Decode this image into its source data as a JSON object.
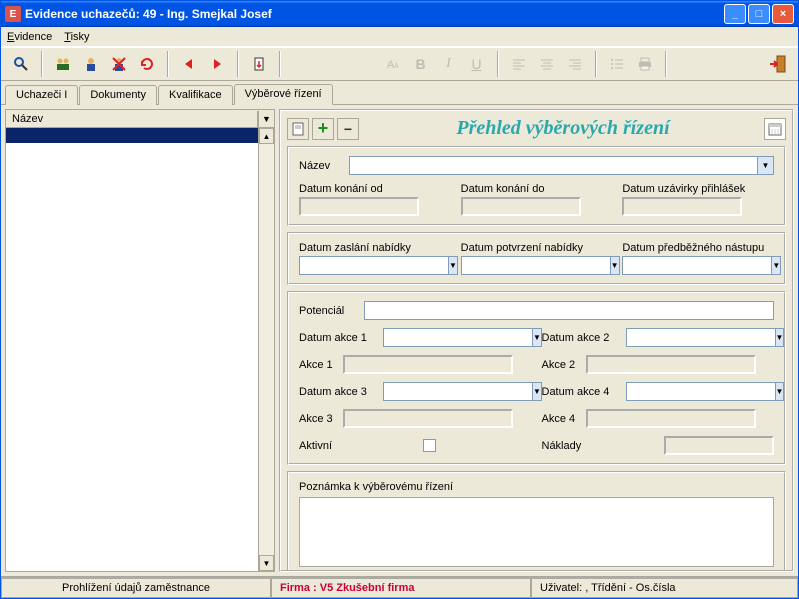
{
  "window": {
    "title": "Evidence uchazečů: 49 - Ing. Smejkal Josef"
  },
  "menu": {
    "evidence": "Evidence",
    "tisky": "Tisky"
  },
  "tabs": {
    "uchazeci": "Uchazeči I",
    "dokumenty": "Dokumenty",
    "kvalifikace": "Kvalifikace",
    "vyberove": "Výběrové řízení"
  },
  "left": {
    "header": "Název"
  },
  "panel": {
    "title": "Přehled výběrových řízení",
    "nazev_label": "Název",
    "datum_konani_od": "Datum konání od",
    "datum_konani_do": "Datum konání do",
    "datum_uzavirky": "Datum uzávirky přihlášek",
    "datum_zaslani": "Datum zaslání nabídky",
    "datum_potvrzeni": "Datum potvrzení nabídky",
    "datum_predbezneho": "Datum předběžného nástupu",
    "potencial": "Potenciál",
    "datum_akce_1": "Datum akce 1",
    "datum_akce_2": "Datum akce 2",
    "akce_1": "Akce 1",
    "akce_2": "Akce 2",
    "datum_akce_3": "Datum akce 3",
    "datum_akce_4": "Datum akce 4",
    "akce_3": "Akce 3",
    "akce_4": "Akce 4",
    "aktivni": "Aktivní",
    "naklady": "Náklady",
    "poznamka": "Poznámka k výběrovému řízení"
  },
  "status": {
    "left": "Prohlížení údajů zaměstnance",
    "firma": "Firma :  V5 Zkušební firma",
    "right": "Uživatel: , Třídění - Os.čísla"
  }
}
